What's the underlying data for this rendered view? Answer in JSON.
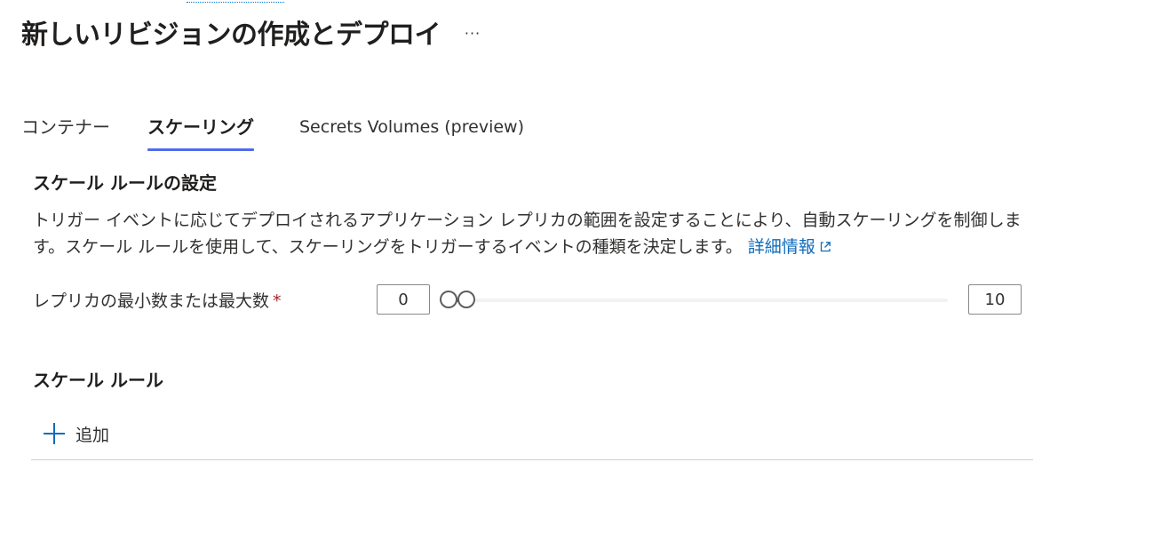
{
  "header": {
    "title": "新しいリビジョンの作成とデプロイ",
    "more_label": "···"
  },
  "tabs": [
    {
      "label": "コンテナー",
      "active": false
    },
    {
      "label": "スケーリング",
      "active": true
    },
    {
      "label": "Secrets Volumes (preview)",
      "active": false
    }
  ],
  "scale_settings": {
    "heading": "スケール ルールの設定",
    "description": "トリガー イベントに応じてデプロイされるアプリケーション レプリカの範囲を設定することにより、自動スケーリングを制御します。スケール ルールを使用して、スケーリングをトリガーするイベントの種類を決定します。",
    "learn_more": "詳細情報",
    "replica_label": "レプリカの最小数または最大数",
    "required_mark": "*",
    "min_value": "0",
    "max_value": "10",
    "range": {
      "min": 0,
      "max": 300,
      "low": 0,
      "high": 0
    }
  },
  "scale_rules": {
    "heading": "スケール ルール",
    "add_label": "追加"
  },
  "colors": {
    "accent": "#4f6bed",
    "link": "#0f6cbd",
    "required": "#a4262c",
    "divider": "#d2d0ce"
  }
}
